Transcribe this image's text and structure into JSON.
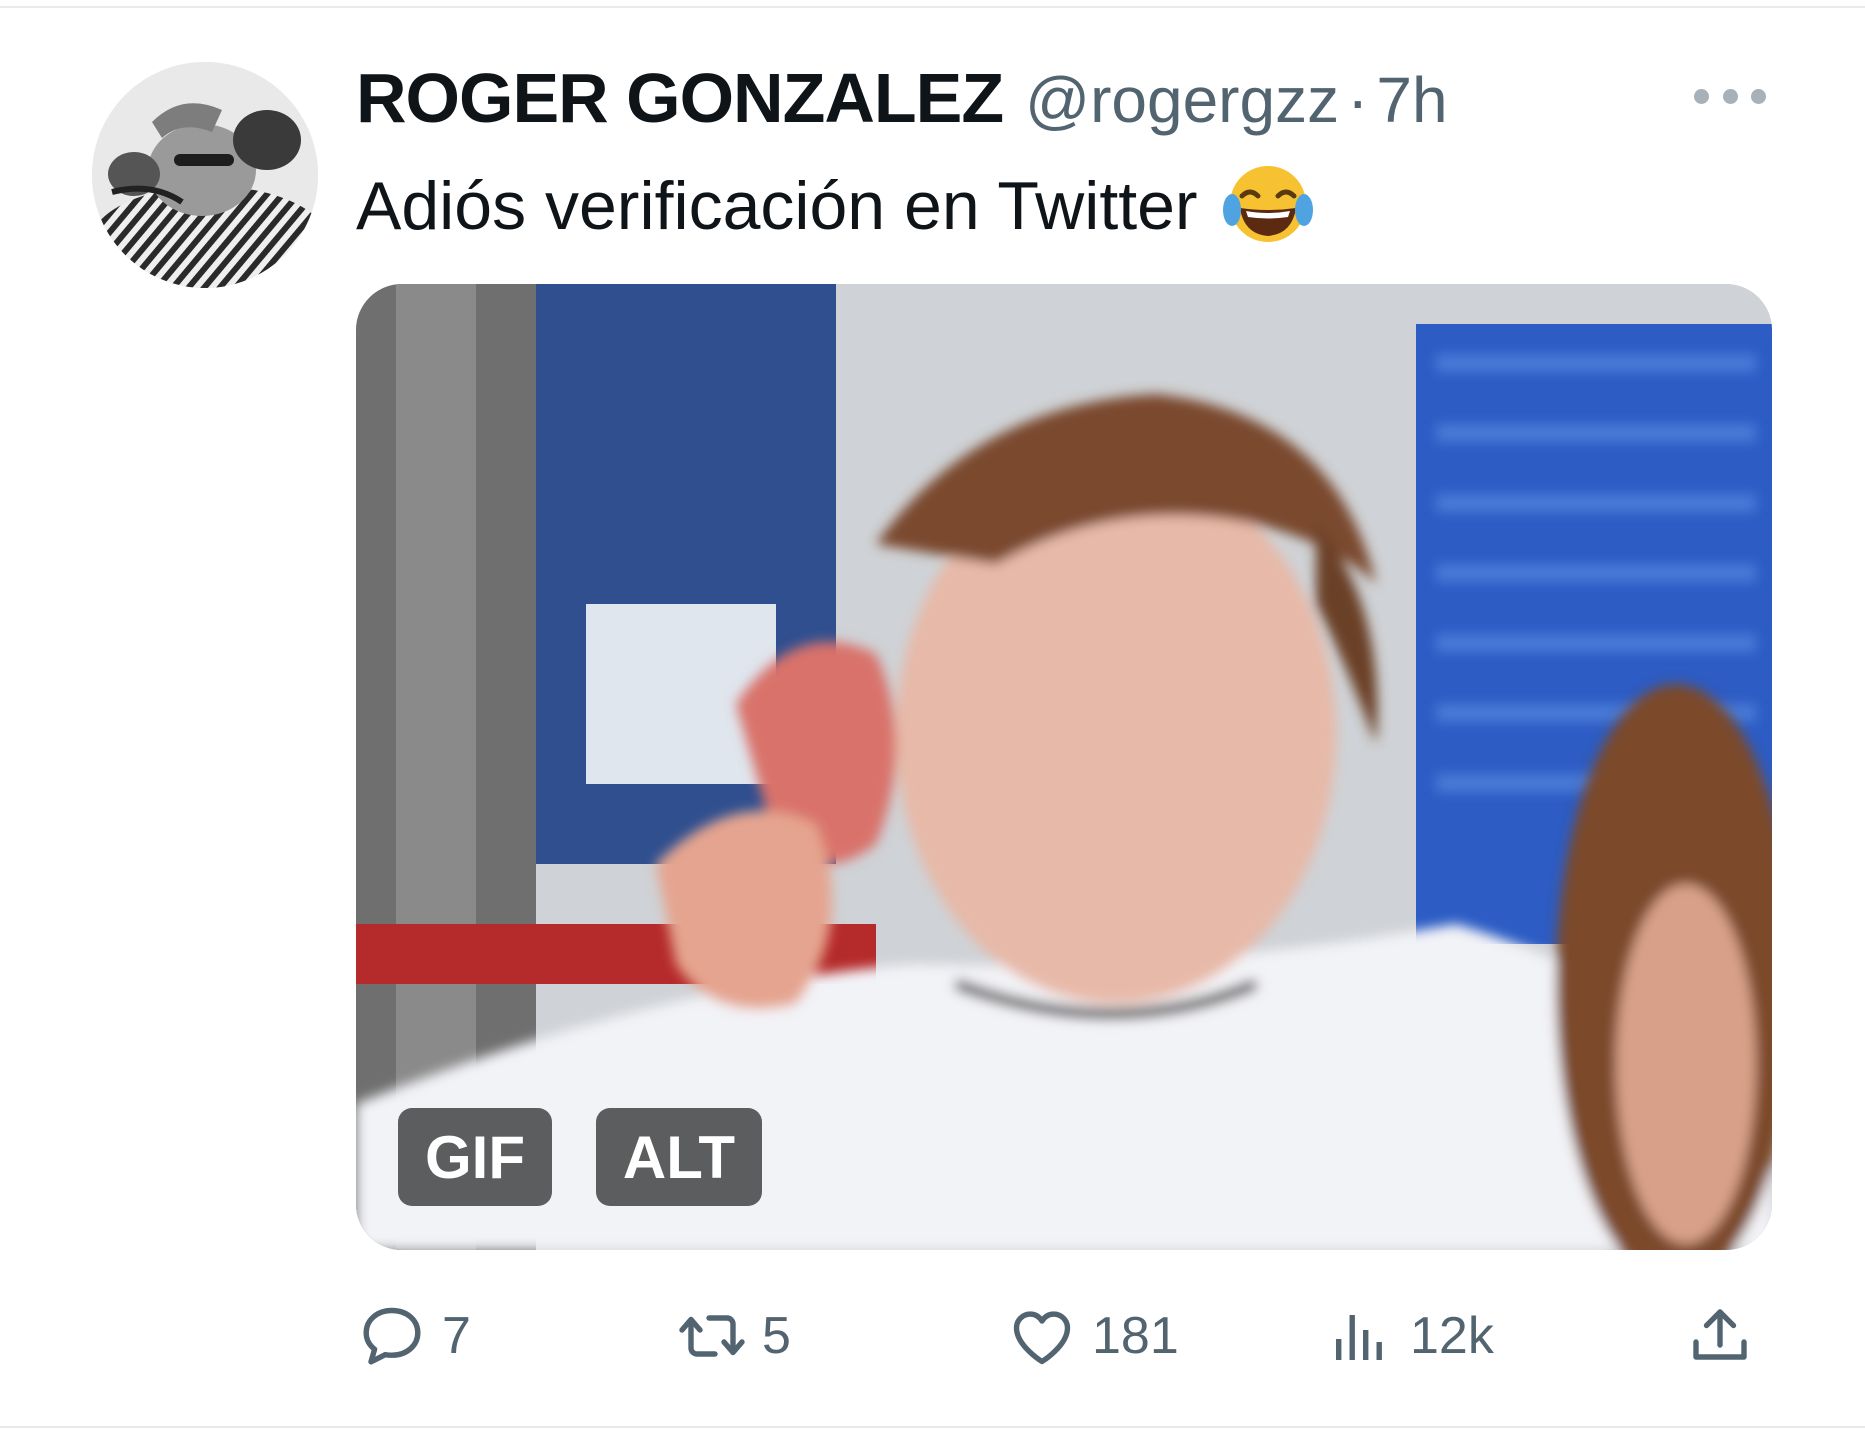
{
  "tweet": {
    "author": {
      "display_name": "ROGER GONZALEZ",
      "handle": "@rogergzz",
      "separator": "·",
      "time": "7h"
    },
    "text": "Adiós verificación en Twitter",
    "emoji": "face-with-tears-of-joy",
    "media": {
      "type": "gif",
      "gif_badge": "GIF",
      "alt_badge": "ALT"
    },
    "stats": {
      "replies": "7",
      "retweets": "5",
      "likes": "181",
      "views": "12k"
    }
  },
  "icons": {
    "more": "more-horizontal-icon",
    "reply": "reply-bubble-icon",
    "retweet": "retweet-arrows-icon",
    "like": "heart-icon",
    "views": "analytics-bars-icon",
    "share": "share-upload-icon"
  },
  "colors": {
    "text_primary": "#0f1419",
    "text_secondary": "#536471",
    "divider": "#e8eaec",
    "badge_bg": "#000000"
  }
}
